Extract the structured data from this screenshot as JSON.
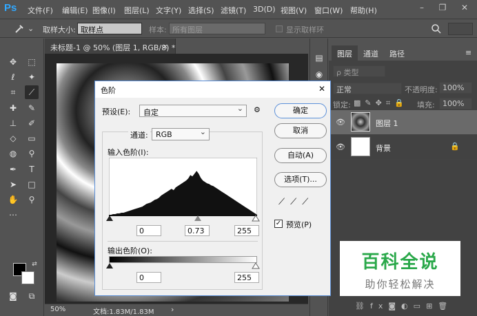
{
  "app": {
    "logo": "Ps"
  },
  "menu": [
    "文件(F)",
    "编辑(E)",
    "图像(I)",
    "图层(L)",
    "文字(Y)",
    "选择(S)",
    "滤镜(T)",
    "3D(D)",
    "视图(V)",
    "窗口(W)",
    "帮助(H)"
  ],
  "window_controls": {
    "minimize": "–",
    "restore": "❐",
    "close": "✕"
  },
  "options": {
    "sample_size_label": "取样大小:",
    "sample_size_value": "取样点",
    "sample_label": "样本:",
    "sample_value": "所有图层",
    "show_ring_label": "显示取样环"
  },
  "document": {
    "tab_title": "未标题-1 @ 50% (图层 1, RGB/8) *",
    "tab_close": "×",
    "zoom": "50%",
    "doc_info": "文档:1.83M/1.83M",
    "arrow": "›"
  },
  "layers_panel": {
    "tabs": [
      "图层",
      "通道",
      "路径"
    ],
    "filter_label": "ρ 类型",
    "blend_mode": "正常",
    "opacity_label": "不透明度:",
    "opacity_value": "100%",
    "lock_label": "锁定:",
    "fill_label": "填充:",
    "fill_value": "100%",
    "layers": [
      {
        "name": "图层 1"
      },
      {
        "name": "背景"
      }
    ],
    "bottom_icons": [
      "link-icon",
      "fx-icon",
      "mask-icon",
      "adjustment-icon",
      "group-icon",
      "new-layer-icon",
      "trash-icon"
    ],
    "fx_text": "fx"
  },
  "dialog": {
    "title": "色阶",
    "close": "✕",
    "preset_label": "预设(E):",
    "preset_value": "自定",
    "channel_label": "通道:",
    "channel_value": "RGB",
    "input_label": "输入色阶(I):",
    "input_values": [
      "0",
      "0.73",
      "255"
    ],
    "output_label": "输出色阶(O):",
    "output_values": [
      "0",
      "255"
    ],
    "buttons": {
      "ok": "确定",
      "cancel": "取消",
      "auto": "自动(A)",
      "options": "选项(T)..."
    },
    "preview_label": "预览(P)"
  },
  "histogram": [
    2,
    2,
    3,
    3,
    4,
    4,
    5,
    5,
    6,
    7,
    8,
    9,
    10,
    11,
    12,
    13,
    14,
    16,
    18,
    19,
    20,
    22,
    24,
    25,
    27,
    30,
    32,
    34,
    36,
    38,
    40,
    38,
    42,
    44,
    46,
    48,
    50,
    52,
    55,
    60,
    58,
    62,
    66,
    62,
    56,
    52,
    50,
    48,
    47,
    45,
    44,
    42,
    40,
    38,
    36,
    34,
    32,
    30,
    28,
    26,
    24,
    22,
    20,
    18,
    16,
    14,
    12,
    10,
    8,
    6,
    4,
    2
  ],
  "watermark": {
    "title": "百科全说",
    "subtitle": "助你轻松解决"
  },
  "colors": {
    "ps_blue": "#31a8ff",
    "ui_dark": "#535353",
    "watermark_green": "#2aa84a"
  }
}
